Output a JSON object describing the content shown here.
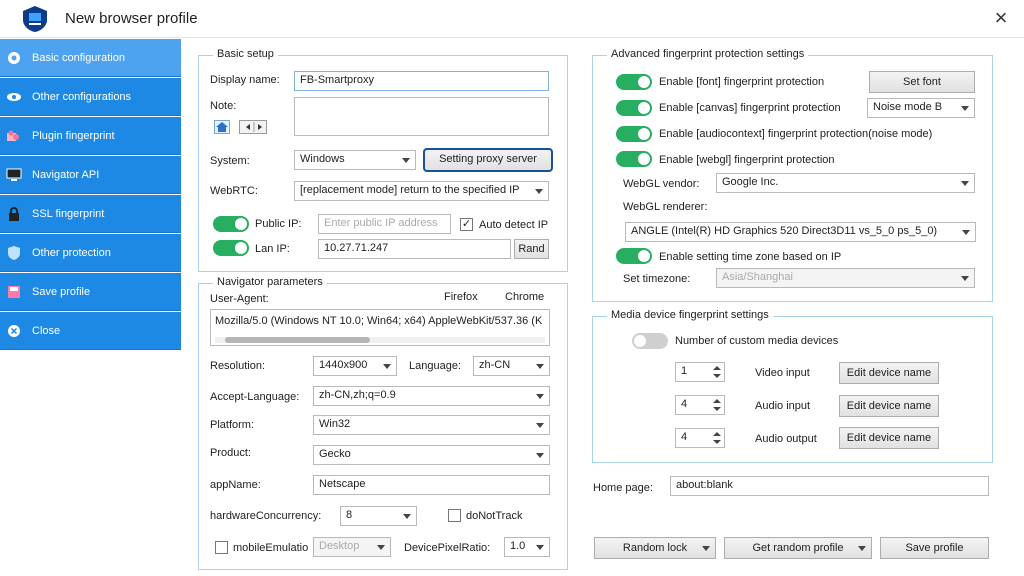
{
  "window": {
    "title": "New browser profile",
    "close_icon": "×"
  },
  "sidebar": {
    "items": [
      {
        "label": "Basic configuration",
        "icon": "gear-circle-icon"
      },
      {
        "label": "Other configurations",
        "icon": "eye-icon"
      },
      {
        "label": "Plugin fingerprint",
        "icon": "puzzle-icon"
      },
      {
        "label": "Navigator API",
        "icon": "monitor-icon"
      },
      {
        "label": "SSL fingerprint",
        "icon": "lock-icon"
      },
      {
        "label": "Other protection",
        "icon": "shield-icon"
      },
      {
        "label": "Save profile",
        "icon": "save-icon"
      },
      {
        "label": "Close",
        "icon": "close-circle-icon"
      }
    ]
  },
  "basic_setup": {
    "title": "Basic setup",
    "display_name_label": "Display name:",
    "display_name_value": "FB-Smartproxy",
    "note_label": "Note:",
    "system_label": "System:",
    "system_value": "Windows",
    "setting_proxy_button": "Setting proxy server",
    "webrtc_label": "WebRTC:",
    "webrtc_value": "[replacement mode] return to the specified IP",
    "public_ip_label": "Public IP:",
    "public_ip_placeholder": "Enter public IP address",
    "auto_detect_label": "Auto detect IP",
    "auto_detect_checked": true,
    "lan_ip_label": "Lan IP:",
    "lan_ip_value": "10.27.71.247",
    "rand_button": "Rand"
  },
  "navigator": {
    "title": "Navigator parameters",
    "user_agent_label": "User-Agent:",
    "firefox_link": "Firefox",
    "chrome_link": "Chrome",
    "user_agent_value": "Mozilla/5.0 (Windows NT 10.0; Win64; x64) AppleWebKit/537.36 (K",
    "resolution_label": "Resolution:",
    "resolution_value": "1440x900",
    "language_label": "Language:",
    "language_value": "zh-CN",
    "accept_language_label": "Accept-Language:",
    "accept_language_value": "zh-CN,zh;q=0.9",
    "platform_label": "Platform:",
    "platform_value": "Win32",
    "product_label": "Product:",
    "product_value": "Gecko",
    "appname_label": "appName:",
    "appname_value": "Netscape",
    "hardware_label": "hardwareConcurrency:",
    "hardware_value": "8",
    "donottrack_label": "doNotTrack",
    "mobile_label": "mobileEmulatio",
    "mobile_select_value": "Desktop",
    "dpr_label": "DevicePixelRatio:",
    "dpr_value": "1.0"
  },
  "advanced": {
    "title": "Advanced fingerprint protection settings",
    "font_label": "Enable [font] fingerprint protection",
    "set_font_button": "Set font",
    "canvas_label": "Enable [canvas] fingerprint protection",
    "canvas_mode": "Noise mode B",
    "audio_label": "Enable [audiocontext] fingerprint  protection(noise mode)",
    "webgl_label": "Enable [webgl] fingerprint protection",
    "webgl_vendor_label": "WebGL vendor:",
    "webgl_vendor_value": "Google Inc.",
    "webgl_renderer_label": "WebGL renderer:",
    "webgl_renderer_value": "ANGLE (Intel(R) HD Graphics 520 Direct3D11 vs_5_0 ps_5_0)",
    "timezone_toggle_label": "Enable setting time zone based on IP",
    "set_timezone_label": "Set timezone:",
    "timezone_value": "Asia/Shanghai"
  },
  "media": {
    "title": "Media device fingerprint settings",
    "custom_label": "Number of custom media devices",
    "video_count": "1",
    "video_label": "Video input",
    "audio_in_count": "4",
    "audio_in_label": "Audio input",
    "audio_out_count": "4",
    "audio_out_label": "Audio output",
    "edit_button": "Edit device name"
  },
  "home_page": {
    "label": "Home page:",
    "value": "about:blank"
  },
  "footer": {
    "random_lock": "Random lock",
    "get_random_profile": "Get random profile",
    "save_profile": "Save profile"
  },
  "colors": {
    "sidebar": "#1e88e5",
    "sidebar_active": "#4da3f0",
    "toggle_on": "#27ae60",
    "group_border": "#a9d2f2"
  }
}
